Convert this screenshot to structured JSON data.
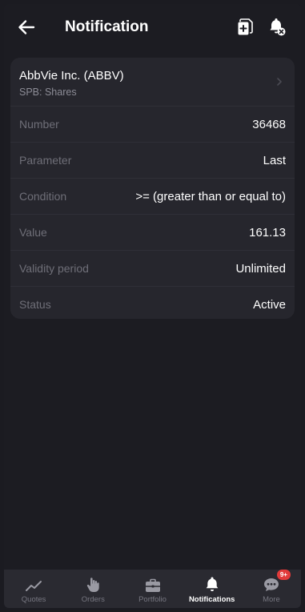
{
  "header": {
    "title": "Notification"
  },
  "instrument": {
    "name": "AbbVie Inc. (ABBV)",
    "exchange": "SPB: Shares"
  },
  "details": [
    {
      "label": "Number",
      "value": "36468"
    },
    {
      "label": "Parameter",
      "value": "Last"
    },
    {
      "label": "Condition",
      "value": ">= (greater than or equal to)"
    },
    {
      "label": "Value",
      "value": "161.13"
    },
    {
      "label": "Validity period",
      "value": "Unlimited"
    },
    {
      "label": "Status",
      "value": "Active"
    }
  ],
  "bottom_nav": {
    "items": [
      {
        "label": "Quotes",
        "icon": "chart-line-icon"
      },
      {
        "label": "Orders",
        "icon": "hand-pointer-icon"
      },
      {
        "label": "Portfolio",
        "icon": "briefcase-icon"
      },
      {
        "label": "Notifications",
        "icon": "bell-icon",
        "active": true
      },
      {
        "label": "More",
        "icon": "more-dots-icon",
        "badge": "9+"
      }
    ]
  },
  "colors": {
    "background": "#1c1c22",
    "card": "#26262d",
    "muted_text": "#6f6f78",
    "badge": "#e23a3a"
  }
}
